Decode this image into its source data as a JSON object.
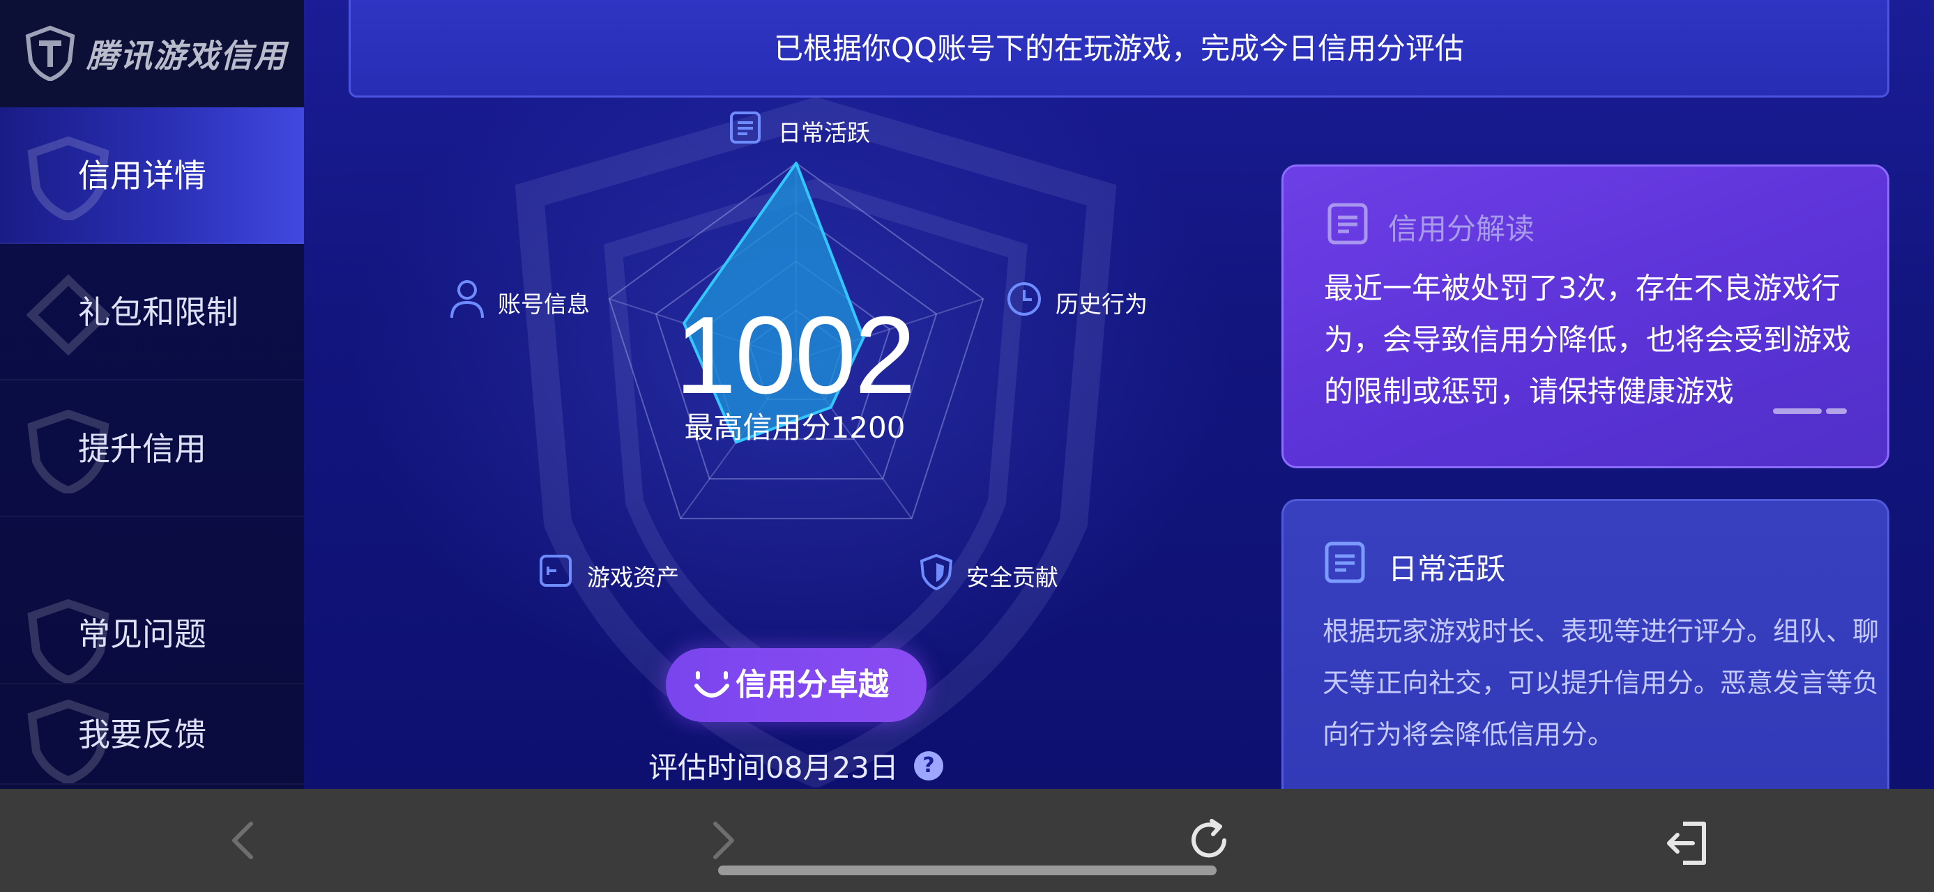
{
  "app": {
    "logo_text": "腾讯游戏信用"
  },
  "sidebar": {
    "items": [
      {
        "label": "信用详情",
        "active": true
      },
      {
        "label": "礼包和限制",
        "active": false
      },
      {
        "label": "提升信用",
        "active": false
      },
      {
        "label": "常见问题",
        "active": false
      },
      {
        "label": "我要反馈",
        "active": false
      }
    ]
  },
  "banner": {
    "text": "已根据你QQ账号下的在玩游戏，完成今日信用分评估"
  },
  "radar": {
    "score": "1002",
    "max_label": "最高信用分1200",
    "axes": [
      {
        "label": "日常活跃",
        "icon": "document-icon"
      },
      {
        "label": "历史行为",
        "icon": "clock-icon"
      },
      {
        "label": "安全贡献",
        "icon": "shield-icon"
      },
      {
        "label": "游戏资产",
        "icon": "wallet-icon"
      },
      {
        "label": "账号信息",
        "icon": "user-icon"
      }
    ],
    "levels": [
      1.0,
      0.36,
      0.3,
      0.52,
      0.6
    ]
  },
  "badge": {
    "label": "信用分卓越",
    "icon": "smile-icon"
  },
  "eval_time": "评估时间08月23日",
  "help": "?",
  "interpretation_card": {
    "title": "信用分解读",
    "body": "最近一年被处罚了3次，存在不良游戏行为，会导致信用分降低，也将会受到游戏的限制或惩罚，请保持健康游戏"
  },
  "daily_card": {
    "title": "日常活跃",
    "body": "根据玩家游戏时长、表现等进行评分。组队、聊天等正向社交，可以提升信用分。恶意发言等负向行为将会降低信用分。"
  },
  "colors": {
    "accent_purple": "#7a45ee",
    "radar_fill": "#1d8fd8",
    "radar_stroke": "#34c7ff",
    "icon_blue": "#6f8cff"
  }
}
